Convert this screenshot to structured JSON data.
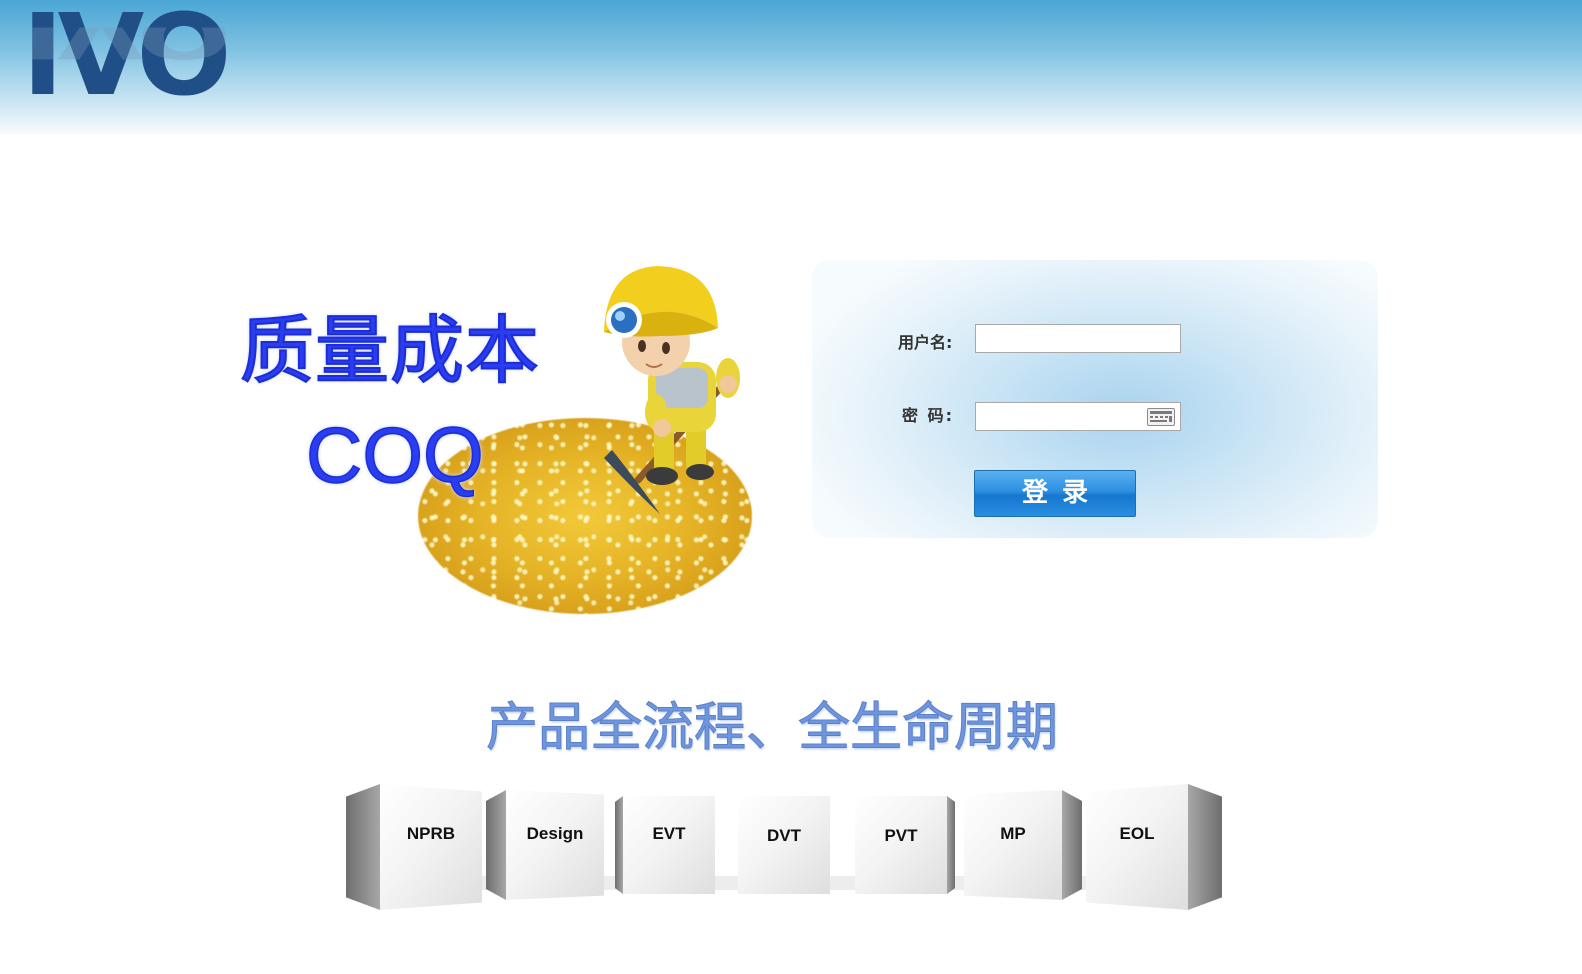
{
  "header": {
    "logo_text": "IVO"
  },
  "hero": {
    "title_cn": "质量成本",
    "title_en": "COQ"
  },
  "login": {
    "username_label": "用户名:",
    "password_label": "密  码:",
    "username_value": "",
    "password_value": "",
    "submit_label": "登录"
  },
  "lifecycle": {
    "slogan": "产品全流程、全生命周期",
    "stages": [
      "NPRB",
      "Design",
      "EVT",
      "DVT",
      "PVT",
      "MP",
      "EOL"
    ]
  },
  "colors": {
    "title_blue": "#2a3df0",
    "slogan_blue": "#6f96dc",
    "button_blue": "#2c8fe0",
    "header_blue": "#4aa6d4",
    "logo_navy": "#1f4f86"
  },
  "icons": {
    "password_keyboard": "soft-keyboard-icon",
    "mascot": "miner-mascot"
  }
}
